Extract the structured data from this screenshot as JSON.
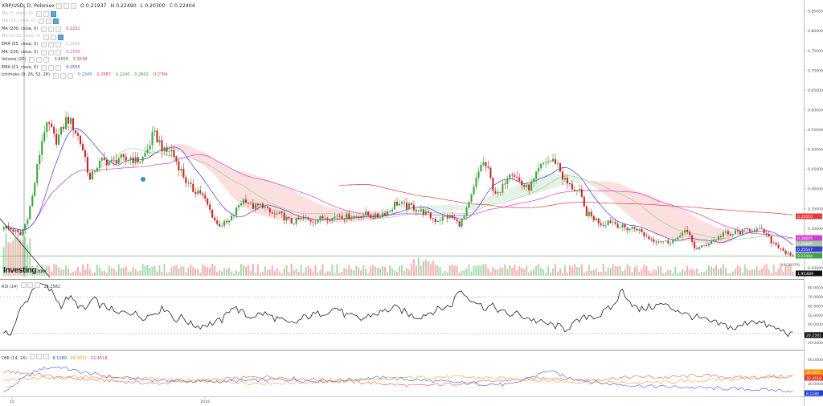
{
  "header": {
    "symbol": "XRP/USD, D, Poloniex",
    "open": "O 0.21937",
    "high": "H 0.22490",
    "low": "L 0.20300",
    "close": "C 0.22404"
  },
  "indicators": [
    {
      "name": "MA (7, close, 0)",
      "value": "",
      "color": "#bbbbbb",
      "faded": true,
      "active": true
    },
    {
      "name": "MA (25, close, 0)",
      "value": "",
      "color": "#bbbbbb",
      "faded": true,
      "active": true
    },
    {
      "name": "MA (200, close, 0)",
      "value": "0.3201",
      "color": "#e53935",
      "faded": false,
      "active": false
    },
    {
      "name": "MA (1718, close, 0)",
      "value": "",
      "color": "#bbbbbb",
      "faded": true,
      "active": true
    },
    {
      "name": "EMA (55, close, 0)",
      "value": "0.2686",
      "color": "#9ccc9c",
      "faded": false,
      "active": false
    },
    {
      "name": "MA (100, close, 0)",
      "value": "0.2700",
      "color": "#d63bd6",
      "faded": false,
      "active": false
    },
    {
      "name": "Volume (20)",
      "value": "3.8658",
      "value2": "1.9538",
      "color": "#2e7d32",
      "faded": false,
      "active": false
    },
    {
      "name": "EMA (21, close, 0)",
      "value": "0.2555",
      "color": "#3b3bd6",
      "faded": false,
      "active": false
    },
    {
      "name": "Ichimoku (9, 26, 52, 26)",
      "value": "0.2345",
      "value2": "0.2587",
      "value3": "0.2240",
      "value4": "0.2802",
      "value5": "0.2784",
      "color": "#1e88e5",
      "faded": false,
      "active": false
    }
  ],
  "price_axis": {
    "ticks": [
      "0.85000",
      "0.80000",
      "0.75000",
      "0.70000",
      "0.65000",
      "0.60000",
      "0.55000",
      "0.50000",
      "0.45000",
      "0.40000",
      "0.35000",
      "0.30000",
      "0.25000",
      "0.20000"
    ],
    "badges": [
      {
        "label": "0.32010",
        "value": 0.3201,
        "color": "#e53935"
      },
      {
        "label": "0.28695",
        "value": 0.287,
        "color": "#d63bd6"
      },
      {
        "label": "0.26895",
        "value": 0.269,
        "color": "#9ccc9c"
      },
      {
        "label": "0.25547",
        "value": 0.2555,
        "color": "#3b3bd6"
      },
      {
        "label": "0.22404",
        "value": 0.224,
        "color": "#43a047"
      },
      {
        "label": "1.9538M",
        "value": 0.199,
        "color": "#111111"
      }
    ],
    "low_marker": "0(0.20379)"
  },
  "rsi": {
    "label": "RSI (14)",
    "value": "28.2582",
    "ticks": [
      "80.0000",
      "70.0000",
      "60.0000",
      "50.0000",
      "40.0000",
      "30.0000",
      "20.0000"
    ],
    "badge": "28.2582"
  },
  "dmi": {
    "label": "DMI (14, 14)",
    "v1": "8.1180",
    "v2": "28.3071",
    "v3": "32.4518",
    "ticks": [
      "60.0000",
      "40.0000",
      "20.0000"
    ],
    "badges": [
      {
        "label": "28.3071",
        "color": "#fb8c00"
      },
      {
        "label": "32.4518",
        "color": "#e53935"
      },
      {
        "label": "8.1180",
        "color": "#1e3bd6"
      }
    ]
  },
  "time_axis": {
    "labels": [
      {
        "label": "15",
        "pos": 0.015
      },
      {
        "label": "2019",
        "pos": 0.255
      }
    ]
  },
  "branding": {
    "logo": "Investing",
    "suffix": ".com"
  },
  "chart_data": {
    "type": "line",
    "title": "XRP/USD, D, Poloniex",
    "series": [
      {
        "name": "Close",
        "values": [
          0.305,
          0.3,
          0.292,
          0.282,
          0.32,
          0.38,
          0.47,
          0.55,
          0.56,
          0.52,
          0.545,
          0.58,
          0.56,
          0.53,
          0.49,
          0.42,
          0.455,
          0.47,
          0.47,
          0.465,
          0.48,
          0.47,
          0.48,
          0.47,
          0.475,
          0.5,
          0.54,
          0.52,
          0.49,
          0.5,
          0.47,
          0.44,
          0.41,
          0.395,
          0.395,
          0.37,
          0.34,
          0.31,
          0.31,
          0.315,
          0.335,
          0.365,
          0.375,
          0.355,
          0.355,
          0.36,
          0.34,
          0.335,
          0.335,
          0.325,
          0.315,
          0.32,
          0.325,
          0.32,
          0.32,
          0.325,
          0.33,
          0.325,
          0.335,
          0.33,
          0.33,
          0.33,
          0.335,
          0.335,
          0.33,
          0.33,
          0.34,
          0.345,
          0.365,
          0.36,
          0.355,
          0.355,
          0.345,
          0.34,
          0.33,
          0.32,
          0.325,
          0.33,
          0.325,
          0.31,
          0.33,
          0.37,
          0.42,
          0.47,
          0.45,
          0.4,
          0.38,
          0.42,
          0.45,
          0.43,
          0.41,
          0.4,
          0.42,
          0.45,
          0.47,
          0.47,
          0.47,
          0.43,
          0.41,
          0.4,
          0.39,
          0.34,
          0.33,
          0.32,
          0.31,
          0.32,
          0.315,
          0.305,
          0.3,
          0.3,
          0.3,
          0.285,
          0.275,
          0.27,
          0.27,
          0.265,
          0.27,
          0.27,
          0.3,
          0.28,
          0.25,
          0.25,
          0.26,
          0.27,
          0.275,
          0.29,
          0.28,
          0.29,
          0.29,
          0.295,
          0.3,
          0.295,
          0.29,
          0.27,
          0.26,
          0.25,
          0.235,
          0.224
        ]
      },
      {
        "name": "RSI",
        "values": [
          28,
          32,
          55,
          68,
          85,
          82,
          75,
          60,
          70,
          62,
          55,
          68,
          60,
          58,
          50,
          55,
          52,
          48,
          50,
          55,
          58,
          45,
          48,
          40,
          38,
          40,
          42,
          45,
          60,
          55,
          48,
          50,
          52,
          48,
          45,
          40,
          42,
          48,
          50,
          52,
          55,
          58,
          50,
          48,
          45,
          50,
          52,
          55,
          58,
          55,
          50,
          48,
          52,
          55,
          58,
          60,
          78,
          70,
          65,
          58,
          60,
          55,
          50,
          52,
          48,
          45,
          42,
          40,
          38,
          35,
          40,
          45,
          50,
          48,
          55,
          60,
          78,
          65,
          55,
          58,
          60,
          62,
          58,
          55,
          50,
          48,
          45,
          42,
          40,
          38,
          35,
          40,
          45,
          42,
          38,
          35,
          32,
          28
        ]
      },
      {
        "name": "DMI+",
        "values": [
          5,
          28,
          45,
          48,
          40,
          35,
          30,
          28,
          26,
          25,
          24,
          23,
          24,
          25,
          26,
          27,
          25,
          24,
          26,
          28,
          30,
          28,
          26,
          24,
          22,
          20,
          19,
          18,
          30,
          42,
          30,
          25,
          20,
          18,
          16,
          15,
          14,
          13,
          12,
          11,
          10,
          9,
          8
        ]
      },
      {
        "name": "DMI-",
        "values": [
          40,
          38,
          35,
          30,
          28,
          26,
          24,
          22,
          20,
          22,
          24,
          26,
          28,
          30,
          32,
          30,
          28,
          26,
          24,
          22,
          20,
          18,
          16,
          18,
          20,
          22,
          24,
          26,
          28,
          30,
          28,
          26,
          28,
          30,
          32,
          30,
          32,
          34,
          32,
          30,
          31,
          32,
          32
        ]
      }
    ],
    "ylim": [
      0.18,
      0.87
    ],
    "rsi_ylim": [
      15,
      85
    ],
    "dmi_ylim": [
      0,
      70
    ],
    "grid": true
  }
}
